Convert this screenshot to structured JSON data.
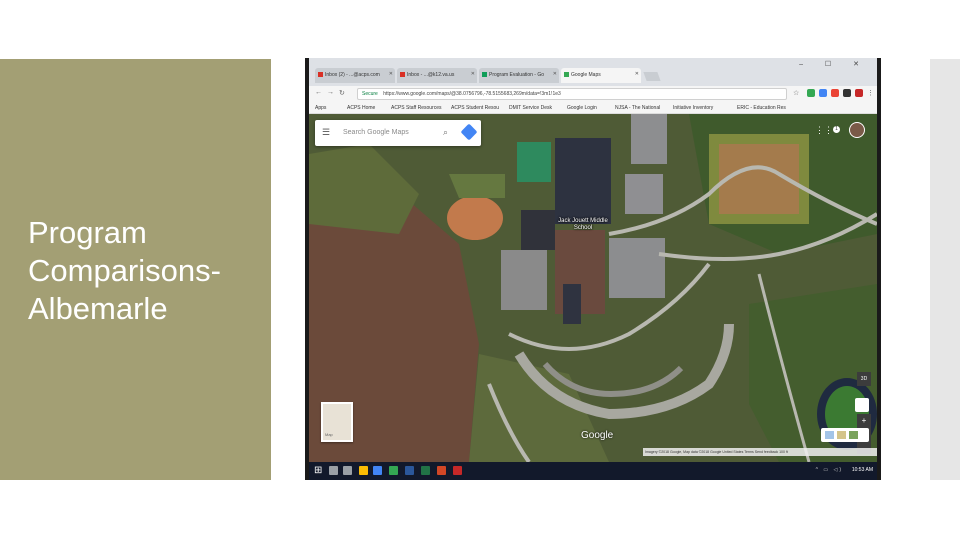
{
  "slide": {
    "title_lines": [
      "Program",
      "Comparisons-",
      "Albemarle"
    ],
    "colors": {
      "panel": "#a39f74",
      "title": "#ffffff",
      "strip": "#e6e6e6"
    }
  },
  "browser": {
    "tabs": [
      {
        "label": "Inbox (2) - ...@acps.com",
        "icon": "gmail-icon"
      },
      {
        "label": "Inbox - ...@k12.va.us",
        "icon": "gmail-icon"
      },
      {
        "label": "Program Evaluation - Go",
        "icon": "drive-icon"
      },
      {
        "label": "Google Maps",
        "icon": "maps-icon"
      }
    ],
    "window_buttons": "– ☐ ✕",
    "address": {
      "secure_label": "Secure",
      "url": "https://www.google.com/maps/@38.0756796,-78.5155683,269m/data=!3m1!1e3"
    },
    "bookmarks": [
      "Apps",
      "ACPS Home",
      "ACPS Staff Resources",
      "ACPS Student Resou",
      "DMIT Service Desk",
      "Google Login",
      "NJSA - The National",
      "Initiative Inventory",
      "ERIC - Education Res"
    ]
  },
  "maps": {
    "search_placeholder": "Search Google Maps",
    "place_label": "Jack Jouett Middle School",
    "notifications": "1",
    "three_d": "3D",
    "zoom_in": "+",
    "zoom_out": "−",
    "minimap_label": "Map",
    "logo": "Google",
    "attribution": "Imagery ©2018 Google, Map data ©2018 Google   United States   Terms   Send feedback   100 ft"
  },
  "taskbar": {
    "start_icon": "windows-icon",
    "time": "10:53 AM",
    "tray": "^ ▭ ◁)"
  }
}
